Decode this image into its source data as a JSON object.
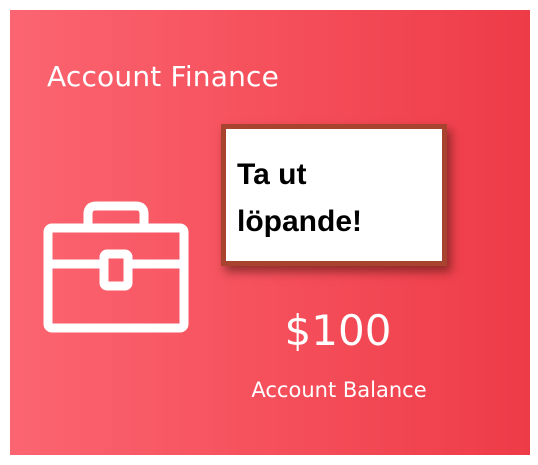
{
  "card": {
    "title": "Account Finance",
    "icon": "briefcase-icon",
    "note_text": "Ta ut löpande!",
    "balance_amount": "$100",
    "balance_label": "Account Balance",
    "colors": {
      "gradient_start": "#fb6571",
      "gradient_end": "#ee3b48",
      "note_border": "#a8432f"
    }
  }
}
